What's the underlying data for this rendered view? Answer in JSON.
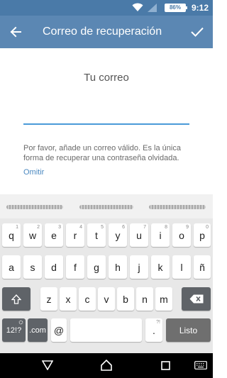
{
  "status_bar": {
    "battery": "86%",
    "time": "9:12"
  },
  "app_bar": {
    "title": "Correo de recuperación",
    "back_icon": "arrow-left-icon",
    "confirm_icon": "check-icon"
  },
  "content": {
    "heading": "Tu correo",
    "email_value": "",
    "info": "Por favor, añade un correo válido. Es la única forma de recuperar una contraseña olvidada.",
    "skip_label": "Omitir"
  },
  "keyboard": {
    "row1": [
      "q",
      "w",
      "e",
      "r",
      "t",
      "y",
      "u",
      "i",
      "o",
      "p"
    ],
    "row1_hints": [
      "1",
      "2",
      "3",
      "4",
      "5",
      "6",
      "7",
      "8",
      "9",
      "0"
    ],
    "row2": [
      "a",
      "s",
      "d",
      "f",
      "g",
      "h",
      "j",
      "k",
      "l",
      "ñ"
    ],
    "row3": [
      "z",
      "x",
      "c",
      "v",
      "b",
      "n",
      "m"
    ],
    "symbols_label": "12!?",
    "com_label": ".com",
    "at_label": "@",
    "period_label": ".",
    "period_hint": "?!",
    "done_label": "Listo"
  },
  "colors": {
    "status_bar": "#4a7aa8",
    "app_bar": "#5b87b3",
    "input_underline": "#4a9ad8",
    "link": "#4a88c0"
  }
}
